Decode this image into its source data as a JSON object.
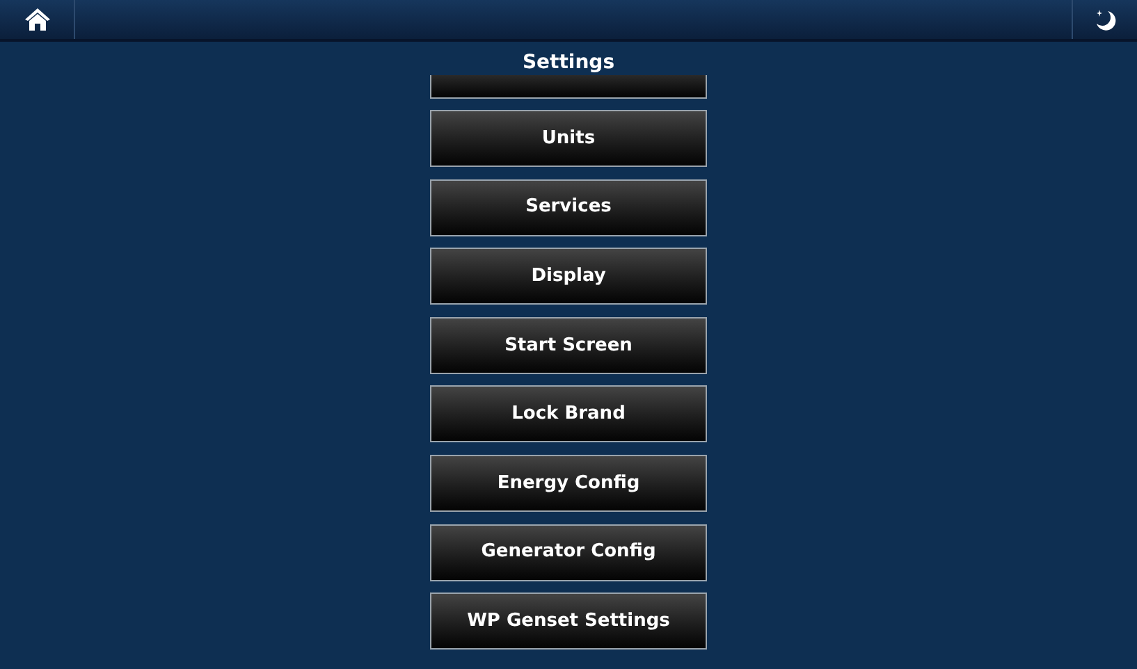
{
  "title": "Settings",
  "buttons": [
    "Units",
    "Services",
    "Display",
    "Start Screen",
    "Lock Brand",
    "Energy Config",
    "Generator Config",
    "WP Genset Settings"
  ]
}
